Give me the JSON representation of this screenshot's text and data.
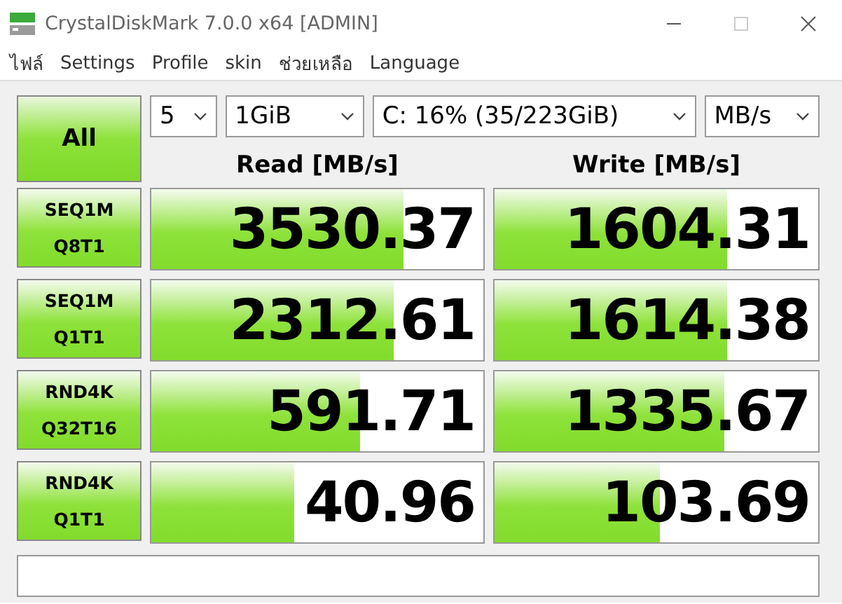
{
  "window": {
    "title": "CrystalDiskMark 7.0.0 x64 [ADMIN]"
  },
  "menu": [
    "ไฟล์",
    "Settings",
    "Profile",
    "skin",
    "ช่วยเหลือ",
    "Language"
  ],
  "all_button": "All",
  "selectors": [
    {
      "value": "5"
    },
    {
      "value": "1GiB"
    },
    {
      "value": "C: 16% (35/223GiB)"
    },
    {
      "value": "MB/s"
    }
  ],
  "headers": [
    "Read [MB/s]",
    "Write [MB/s]"
  ],
  "tests": [
    {
      "line1": "SEQ1M",
      "line2": "Q8T1",
      "read": {
        "value": "3530.37",
        "level": 0.76
      },
      "write": {
        "value": "1604.31",
        "level": 0.72
      }
    },
    {
      "line1": "SEQ1M",
      "line2": "Q1T1",
      "read": {
        "value": "2312.61",
        "level": 0.73
      },
      "write": {
        "value": "1614.38",
        "level": 0.72
      }
    },
    {
      "line1": "RND4K",
      "line2": "Q32T16",
      "read": {
        "value": "591.71",
        "level": 0.63
      },
      "write": {
        "value": "1335.67",
        "level": 0.71
      }
    },
    {
      "line1": "RND4K",
      "line2": "Q1T1",
      "read": {
        "value": "40.96",
        "level": 0.43
      },
      "write": {
        "value": "103.69",
        "level": 0.51
      }
    }
  ]
}
